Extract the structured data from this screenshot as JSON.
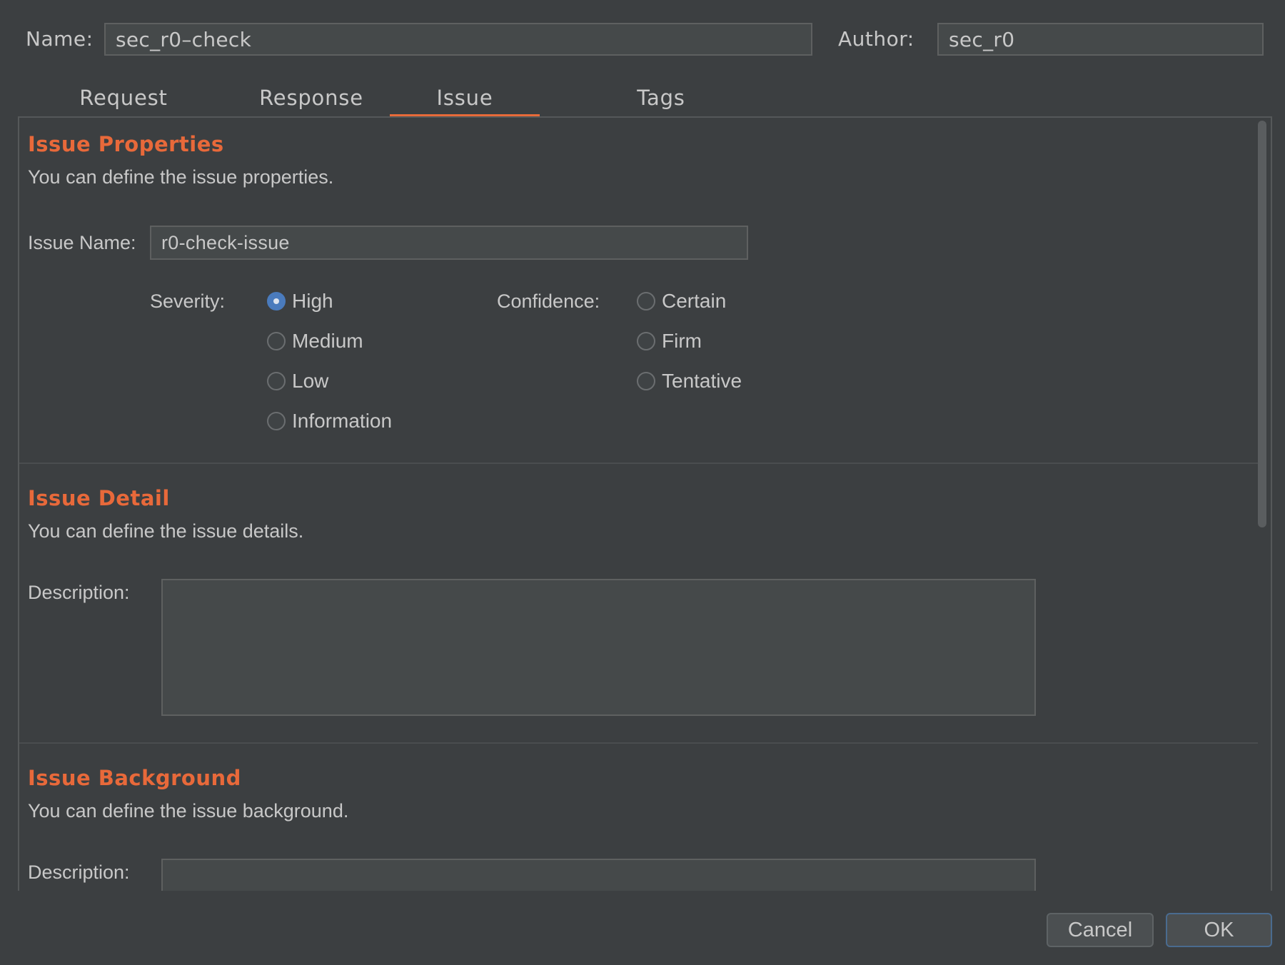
{
  "header": {
    "name_label": "Name:",
    "name_value": "sec_r0–check",
    "author_label": "Author:",
    "author_value": "sec_r0"
  },
  "tabs": [
    {
      "label": "Request",
      "active": false
    },
    {
      "label": "Response",
      "active": false
    },
    {
      "label": "Issue",
      "active": true
    },
    {
      "label": "Tags",
      "active": false
    }
  ],
  "issue_properties": {
    "title": "Issue Properties",
    "description": "You can define the issue properties.",
    "issue_name_label": "Issue Name:",
    "issue_name_value": "r0-check-issue",
    "severity_label": "Severity:",
    "severity_options": [
      "High",
      "Medium",
      "Low",
      "Information"
    ],
    "severity_selected": "High",
    "confidence_label": "Confidence:",
    "confidence_options": [
      "Certain",
      "Firm",
      "Tentative"
    ],
    "confidence_selected": null
  },
  "issue_detail": {
    "title": "Issue Detail",
    "description": "You can define the issue details.",
    "field_label": "Description:",
    "value": ""
  },
  "issue_background": {
    "title": "Issue Background",
    "description": "You can define the issue background.",
    "field_label": "Description:",
    "value": ""
  },
  "buttons": {
    "cancel": "Cancel",
    "ok": "OK"
  },
  "colors": {
    "accent": "#e8693a",
    "radio_selected": "#4a7bbd",
    "background": "#3c3f41"
  }
}
